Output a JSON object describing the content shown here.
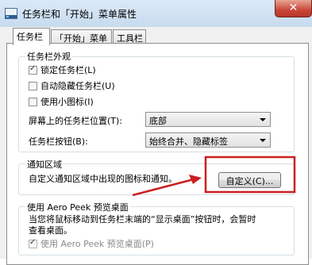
{
  "window": {
    "title": "任务栏和「开始」菜单属性",
    "close_glyph": "✕"
  },
  "tabs": [
    {
      "label": "任务栏",
      "active": true
    },
    {
      "label": "「开始」菜单",
      "active": false
    },
    {
      "label": "工具栏",
      "active": false
    }
  ],
  "appearance": {
    "title": "任务栏外观",
    "lock_taskbar": {
      "label": "锁定任务栏(L)",
      "checked": true
    },
    "auto_hide": {
      "label": "自动隐藏任务栏(U)",
      "checked": false
    },
    "small_icons": {
      "label": "使用小图标(I)",
      "checked": false
    },
    "location_label": "屏幕上的任务栏位置(T):",
    "location_value": "底部",
    "buttons_label": "任务栏按钮(B):",
    "buttons_value": "始终合并、隐藏标签"
  },
  "notification": {
    "title": "通知区域",
    "description": "自定义通知区域中出现的图标和通知。",
    "customize_button": "自定义(C)..."
  },
  "aero_peek": {
    "title": "使用 Aero Peek 预览桌面",
    "description_line1": "当您将鼠标移动到任务栏末端的“显示桌面”按钮时，会暂时",
    "description_line2": "查看桌面。",
    "checkbox": {
      "label": "使用 Aero Peek 预览桌面(P)",
      "checked": true,
      "disabled": true
    }
  },
  "annotation": {
    "highlight_color": "#cc1f1f"
  }
}
